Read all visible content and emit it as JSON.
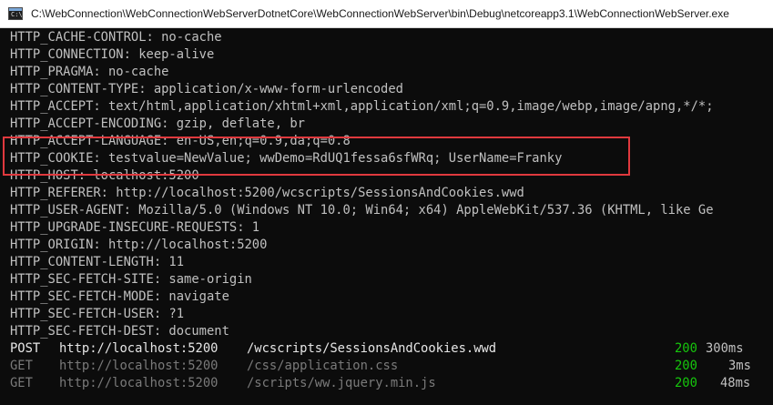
{
  "window": {
    "title": "C:\\WebConnection\\WebConnectionWebServerDotnetCore\\WebConnectionWebServer\\bin\\Debug\\netcoreapp3.1\\WebConnectionWebServer.exe",
    "icon_label": "C:\\"
  },
  "console": {
    "header_lines": [
      "HTTP_CACHE-CONTROL: no-cache",
      "HTTP_CONNECTION: keep-alive",
      "HTTP_PRAGMA: no-cache",
      "HTTP_CONTENT-TYPE: application/x-www-form-urlencoded",
      "HTTP_ACCEPT: text/html,application/xhtml+xml,application/xml;q=0.9,image/webp,image/apng,*/*;",
      "HTTP_ACCEPT-ENCODING: gzip, deflate, br",
      "HTTP_ACCEPT-LANGUAGE: en-US,en;q=0.9,da;q=0.8",
      "HTTP_COOKIE: testvalue=NewValue; wwDemo=RdUQ1fessa6sfWRq; UserName=Franky",
      "HTTP_HOST: localhost:5200",
      "HTTP_REFERER: http://localhost:5200/wcscripts/SessionsAndCookies.wwd",
      "HTTP_USER-AGENT: Mozilla/5.0 (Windows NT 10.0; Win64; x64) AppleWebKit/537.36 (KHTML, like Ge",
      "HTTP_UPGRADE-INSECURE-REQUESTS: 1",
      "HTTP_ORIGIN: http://localhost:5200",
      "HTTP_CONTENT-LENGTH: 11",
      "HTTP_SEC-FETCH-SITE: same-origin",
      "HTTP_SEC-FETCH-MODE: navigate",
      "HTTP_SEC-FETCH-USER: ?1",
      "HTTP_SEC-FETCH-DEST: document"
    ],
    "requests": [
      {
        "method": "POST",
        "host": "http://localhost:5200",
        "path": "/wcscripts/SessionsAndCookies.wwd",
        "status": "200",
        "time": "300ms"
      },
      {
        "method": "GET",
        "host": "http://localhost:5200",
        "path": "/css/application.css",
        "status": "200",
        "time": "3ms"
      },
      {
        "method": "GET",
        "host": "http://localhost:5200",
        "path": "/scripts/ww.jquery.min.js",
        "status": "200",
        "time": "48ms"
      }
    ]
  },
  "colors": {
    "background": "#0c0c0c",
    "text": "#c0c0c0",
    "status_ok": "#16c60c",
    "dim_text": "#7a7a7a",
    "highlight_border": "#e0393e"
  }
}
